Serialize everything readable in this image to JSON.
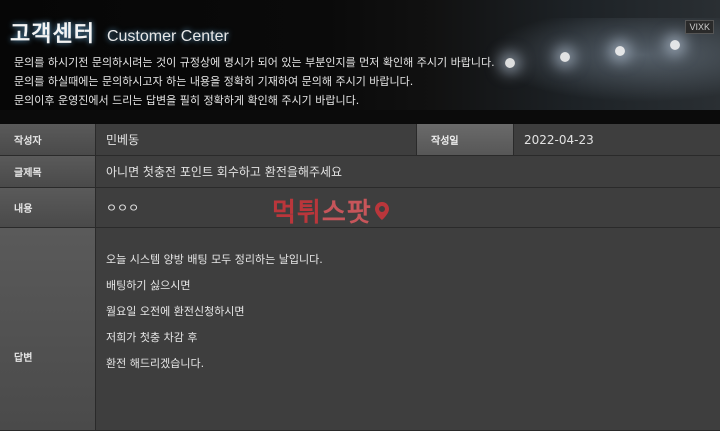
{
  "header": {
    "title_ko": "고객센터",
    "title_en": "Customer Center",
    "sign_text": "VIXK"
  },
  "notice": [
    "문의를 하시기전 문의하시려는 것이 규정상에 명시가 되어 있는 부분인지를 먼저 확인해 주시기 바랍니다.",
    "문의를 하실때에는 문의하시고자 하는 내용을 정확히 기재하여 문의해 주시기 바랍니다.",
    "문의이후 운영진에서 드리는 답변을 필히 정확하게 확인해 주시기 바랍니다."
  ],
  "form": {
    "author_label": "작성자",
    "author_value": "민베동",
    "date_label": "작성일",
    "date_value": "2022-04-23",
    "subject_label": "글제목",
    "subject_value": "아니면 첫충전 포인트 회수하고 환전을해주세요",
    "content_label": "내용",
    "content_value": "ㅇㅇㅇ",
    "answer_label": "답변",
    "answer_lines": [
      "오늘 시스템 양방 배팅 모두 정리하는 날입니다.",
      "배팅하기 싫으시면",
      "월요일 오전에 환전신청하시면",
      "저희가 첫충 차감 후",
      "환전 해드리겠습니다."
    ]
  },
  "watermark": {
    "part_a": "먹튀",
    "part_b": "스팟"
  },
  "colors": {
    "watermark_red": "#d0353b",
    "label_bg": "#4f4f4f",
    "value_bg": "#3e3e3e"
  }
}
